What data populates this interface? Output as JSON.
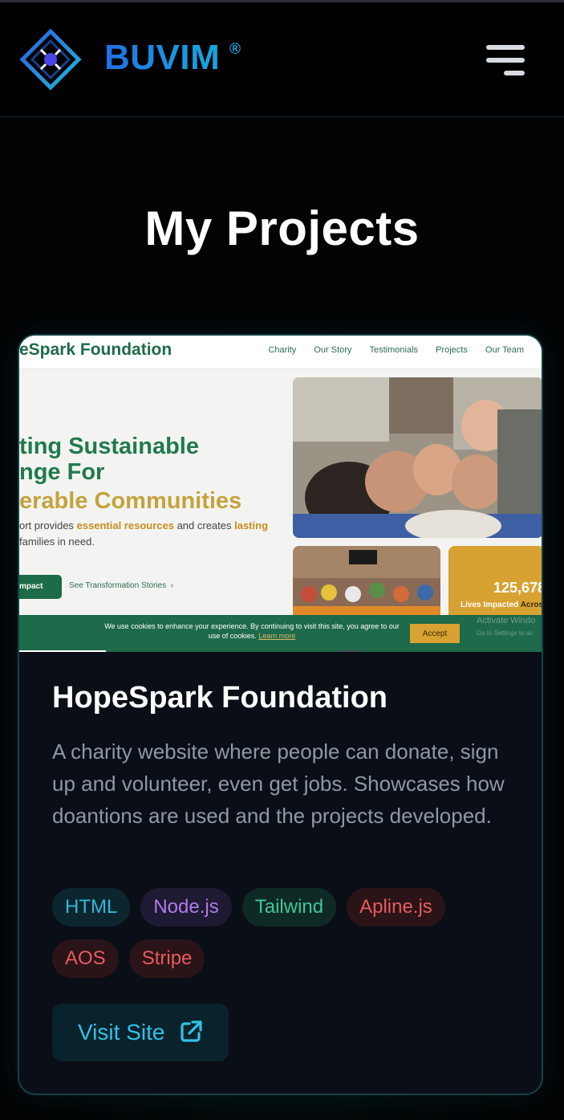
{
  "header": {
    "brand": "BUVIM",
    "registered": "®",
    "logo_icon": "diamond-logo-icon",
    "menu_icon": "hamburger-menu-icon"
  },
  "page": {
    "title": "My Projects"
  },
  "project": {
    "screenshot": {
      "brand": "eSpark Foundation",
      "nav": [
        "Charity",
        "Our Story",
        "Testimonials",
        "Projects",
        "Our Team"
      ],
      "hero_line1": "ting Sustainable",
      "hero_line2": "nge For",
      "hero_line3": "erable Communities",
      "para_a": "ort provides ",
      "para_highlight1": "essential resources",
      "para_b": " and creates ",
      "para_highlight2": "lasting",
      "para_line2": "families in need.",
      "impact_btn": "mpact",
      "see_link": "See Transformation Stories",
      "stat_number": "125,678",
      "stat_label": "Lives Impacted",
      "stat_label_tail": "Across",
      "cookie_text": "We use cookies to enhance your experience. By continuing to visit this site, you agree to our use of cookies.",
      "cookie_link": "Learn more",
      "accept": "Accept",
      "watermark_line1": "Activate Windo",
      "watermark_line2": "Go to Settings to ac"
    },
    "title": "HopeSpark Foundation",
    "description": "A charity website where people can donate, sign up and volunteer, even get jobs. Showcases how doantions are used and the projects developed.",
    "tags": [
      "HTML",
      "Node.js",
      "Tailwind",
      "Apline.js",
      "AOS",
      "Stripe"
    ],
    "tag_colors": {
      "HTML": "#31b8d8",
      "Node.js": "#b07be8",
      "Tailwind": "#3dc79a",
      "Apline.js": "#e85a5e",
      "AOS": "#e85a5e",
      "Stripe": "#e85a5e"
    },
    "visit_label": "Visit Site",
    "visit_icon": "external-link-icon"
  },
  "colors": {
    "background": "#020305",
    "brand_gradient_start": "#1f6fe6",
    "brand_gradient_end": "#18a6de",
    "accent": "#31c2e5",
    "card_border": "#134349"
  }
}
